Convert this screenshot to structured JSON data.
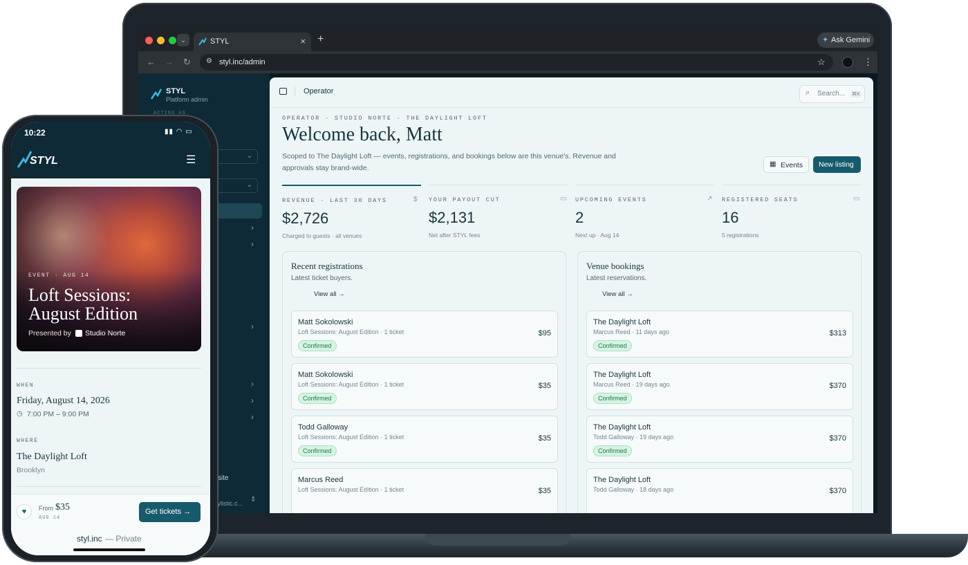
{
  "browser": {
    "tab_title": "STYL",
    "tab_close": "×",
    "new_tab": "+",
    "ask_gemini": "Ask Gemini",
    "url": "styl.inc/admin",
    "star": "☆",
    "menu": "⋮"
  },
  "sidebar": {
    "brand": "STYL",
    "subtitle": "Platform admin",
    "acting_as": "ACTING AS",
    "partial_item_1": "site",
    "partial_item_2": "tylistic.c..."
  },
  "topbar": {
    "title": "Operator",
    "search_placeholder": "Search...",
    "search_shortcut": "⌘K"
  },
  "header": {
    "breadcrumb": "OPERATOR · STUDIO NORTE · THE DAYLIGHT LOFT",
    "title": "Welcome back, Matt",
    "description": "Scoped to The Daylight Loft — events, registrations, and bookings below are this venue's. Revenue and approvals stay brand-wide.",
    "events_button": "Events",
    "new_listing_button": "New listing"
  },
  "stats": [
    {
      "label": "REVENUE · LAST 30 DAYS",
      "value": "$2,726",
      "sub": "Charged to guests · all venues",
      "icon": "$"
    },
    {
      "label": "YOUR PAYOUT CUT",
      "value": "$2,131",
      "sub": "Net after STYL fees",
      "icon": "▭"
    },
    {
      "label": "UPCOMING EVENTS",
      "value": "2",
      "sub": "Next up · Aug 14",
      "icon": "↗"
    },
    {
      "label": "REGISTERED SEATS",
      "value": "16",
      "sub": "5 registrations",
      "icon": "▭"
    }
  ],
  "registrations": {
    "title": "Recent registrations",
    "subtitle": "Latest ticket buyers.",
    "view_all": "View all →",
    "rows": [
      {
        "name": "Matt Sokolowski",
        "detail": "Loft Sessions: August Edition · 1 ticket",
        "amount": "$95",
        "status": "Confirmed"
      },
      {
        "name": "Matt Sokolowski",
        "detail": "Loft Sessions: August Edition · 1 ticket",
        "amount": "$35",
        "status": "Confirmed"
      },
      {
        "name": "Todd Galloway",
        "detail": "Loft Sessions: August Edition · 1 ticket",
        "amount": "$35",
        "status": "Confirmed"
      },
      {
        "name": "Marcus Reed",
        "detail": "Loft Sessions: August Edition · 1 ticket",
        "amount": "$35",
        "status": ""
      }
    ]
  },
  "bookings": {
    "title": "Venue bookings",
    "subtitle": "Latest reservations.",
    "view_all": "View all →",
    "rows": [
      {
        "name": "The Daylight Loft",
        "detail": "Marcus Reed · 11 days ago",
        "amount": "$313",
        "status": "Confirmed"
      },
      {
        "name": "The Daylight Loft",
        "detail": "Marcus Reed · 19 days ago",
        "amount": "$370",
        "status": "Confirmed"
      },
      {
        "name": "The Daylight Loft",
        "detail": "Todd Galloway · 19 days ago",
        "amount": "$370",
        "status": "Confirmed"
      },
      {
        "name": "The Daylight Loft",
        "detail": "Todd Galloway · 18 days ago",
        "amount": "$370",
        "status": ""
      }
    ]
  },
  "phone": {
    "time": "10:22",
    "brand": "STYL",
    "event_eyebrow": "EVENT · AUG 14",
    "event_title_1": "Loft Sessions:",
    "event_title_2": "August Edition",
    "presented_by": "Presented by",
    "presenter": "Studio Norte",
    "when_label": "WHEN",
    "date": "Friday, August 14, 2026",
    "time_range": "7:00 PM – 9:00 PM",
    "where_label": "WHERE",
    "venue": "The Daylight Loft",
    "city": "Brooklyn",
    "from_label": "From",
    "price": "$35",
    "price_date": "AUG 14",
    "cta": "Get tickets →",
    "url_host": "styl.inc",
    "url_suffix": " — Private"
  },
  "colors": {
    "accent": "#175a6b",
    "sidebar": "#0e2a36",
    "confirmed_bg": "#d7f3e3",
    "confirmed_text": "#1b7a46"
  }
}
